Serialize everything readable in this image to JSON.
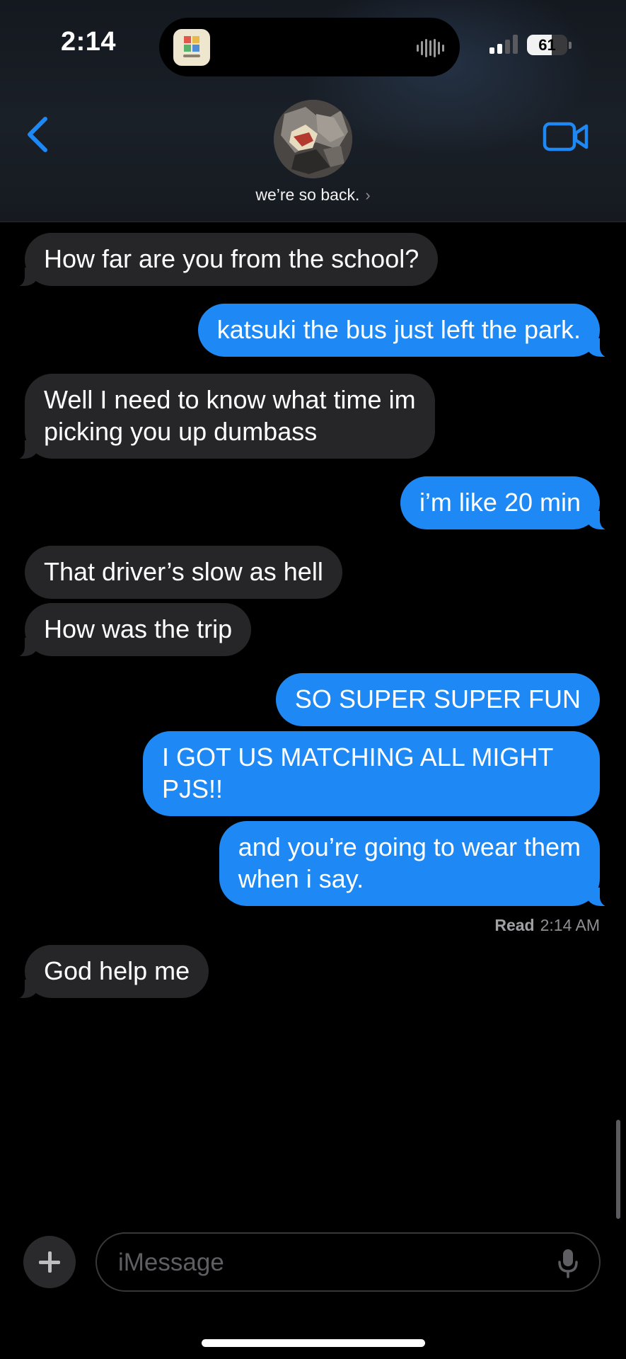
{
  "status_bar": {
    "time": "2:14",
    "battery": "61",
    "battery_level": 0.61
  },
  "header": {
    "contact_name": "we’re so back.",
    "chevron": "›",
    "back_icon": "chevron-left-icon",
    "video_icon": "video-camera-icon"
  },
  "messages": [
    {
      "direction": "in",
      "text": "How far are you from the school?"
    },
    {
      "direction": "out",
      "text": "katsuki the bus just left the park."
    },
    {
      "direction": "in",
      "text": "Well I need to know what time im\npicking you up dumbass"
    },
    {
      "direction": "out",
      "text": "i’m like 20 min"
    },
    {
      "direction": "in",
      "text": "That driver’s slow as hell"
    },
    {
      "direction": "in",
      "text": "How was the trip"
    },
    {
      "direction": "out",
      "text": "SO SUPER SUPER FUN"
    },
    {
      "direction": "out",
      "text": "I GOT US MATCHING ALL MIGHT\nPJS!!"
    },
    {
      "direction": "out",
      "text": "and you’re going to wear them\nwhen i say."
    },
    {
      "direction": "in",
      "text": "God help me"
    }
  ],
  "read_receipt": {
    "label": "Read",
    "time": "2:14 AM"
  },
  "composer": {
    "placeholder": "iMessage",
    "plus_icon": "plus-icon",
    "mic_icon": "microphone-icon"
  },
  "colors": {
    "outgoing": "#1e88f5",
    "incoming": "#262628",
    "accent": "#1e88f5"
  }
}
